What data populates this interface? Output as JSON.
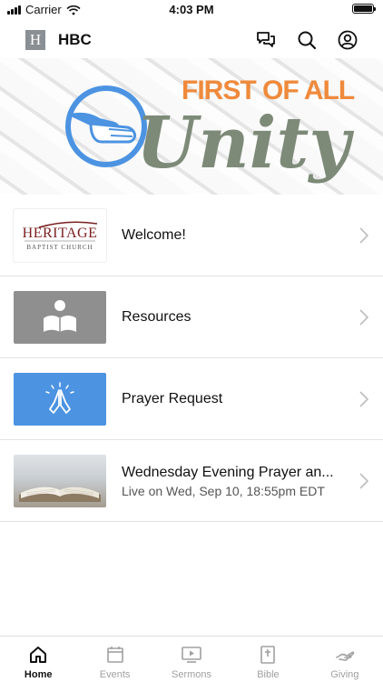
{
  "status_bar": {
    "carrier": "Carrier",
    "time": "4:03 PM"
  },
  "header": {
    "logo_letter": "H",
    "title": "HBC"
  },
  "banner": {
    "line1": "FIRST OF ALL",
    "line2": "Unity"
  },
  "thumb_text": {
    "heritage_name": "HERITAGE",
    "heritage_sub": "BAPTIST CHURCH"
  },
  "list": [
    {
      "title": "Welcome!",
      "thumbnail": "heritage-logo"
    },
    {
      "title": "Resources",
      "thumbnail": "reading-person-icon"
    },
    {
      "title": "Prayer Request",
      "thumbnail": "praying-hands-icon"
    },
    {
      "title": "Wednesday Evening Prayer an...",
      "subtitle": "Live on Wed, Sep 10, 18:55pm EDT",
      "thumbnail": "open-bible-photo"
    }
  ],
  "tabs": [
    {
      "label": "Home",
      "icon": "home-icon",
      "active": true
    },
    {
      "label": "Events",
      "icon": "calendar-icon",
      "active": false
    },
    {
      "label": "Sermons",
      "icon": "play-screen-icon",
      "active": false
    },
    {
      "label": "Bible",
      "icon": "bible-icon",
      "active": false
    },
    {
      "label": "Giving",
      "icon": "giving-hand-icon",
      "active": false
    }
  ],
  "colors": {
    "banner_blue": "#4c93e2",
    "banner_orange": "#ef8a3c",
    "banner_green": "#7d8a78",
    "prayer_blue": "#4c93e2",
    "resources_gray": "#8f8f8f"
  }
}
